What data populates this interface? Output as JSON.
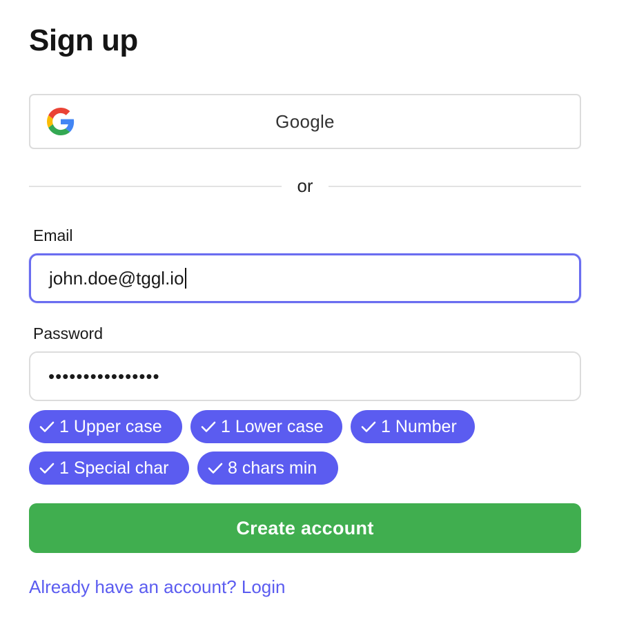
{
  "page": {
    "title": "Sign up"
  },
  "google": {
    "label": "Google",
    "icon": "google-logo-icon"
  },
  "divider": {
    "text": "or"
  },
  "email": {
    "label": "Email",
    "value": "john.doe@tggl.io",
    "focused": true
  },
  "password": {
    "label": "Password",
    "value": "••••••••••••••••"
  },
  "requirements": [
    {
      "label": "1 Upper case",
      "met": true,
      "icon": "check-icon"
    },
    {
      "label": "1 Lower case",
      "met": true,
      "icon": "check-icon"
    },
    {
      "label": "1 Number",
      "met": true,
      "icon": "check-icon"
    },
    {
      "label": "1 Special char",
      "met": true,
      "icon": "check-icon"
    },
    {
      "label": "8 chars min",
      "met": true,
      "icon": "check-icon"
    }
  ],
  "submit": {
    "label": "Create account"
  },
  "login": {
    "text": "Already have an account? Login"
  },
  "colors": {
    "accent": "#5b5cf0",
    "focus_border": "#6a6df0",
    "primary_button": "#40ae4f",
    "border": "#dcdcdc"
  }
}
